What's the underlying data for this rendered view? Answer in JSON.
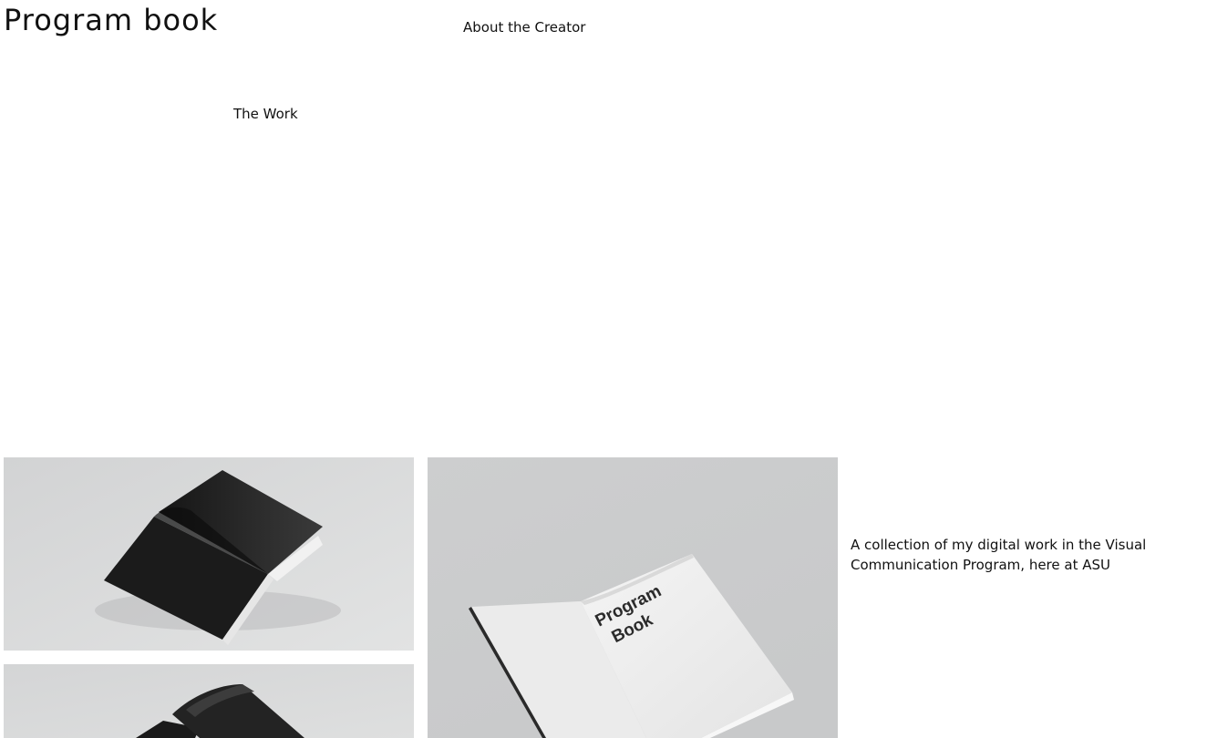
{
  "header": {
    "title": "Program book"
  },
  "nav": {
    "about_label": "About the Creator",
    "work_label": "The Work"
  },
  "gallery": {
    "cover_text_line1": "Program",
    "cover_text_line2": "Book"
  },
  "content": {
    "description": "A collection of my digital work in the Visual Communication Program, here at ASU"
  },
  "colors": {
    "background": "#ffffff",
    "text": "#111111",
    "photo_backdrop": "#d6d7d8",
    "book_black": "#1c1c1c"
  }
}
